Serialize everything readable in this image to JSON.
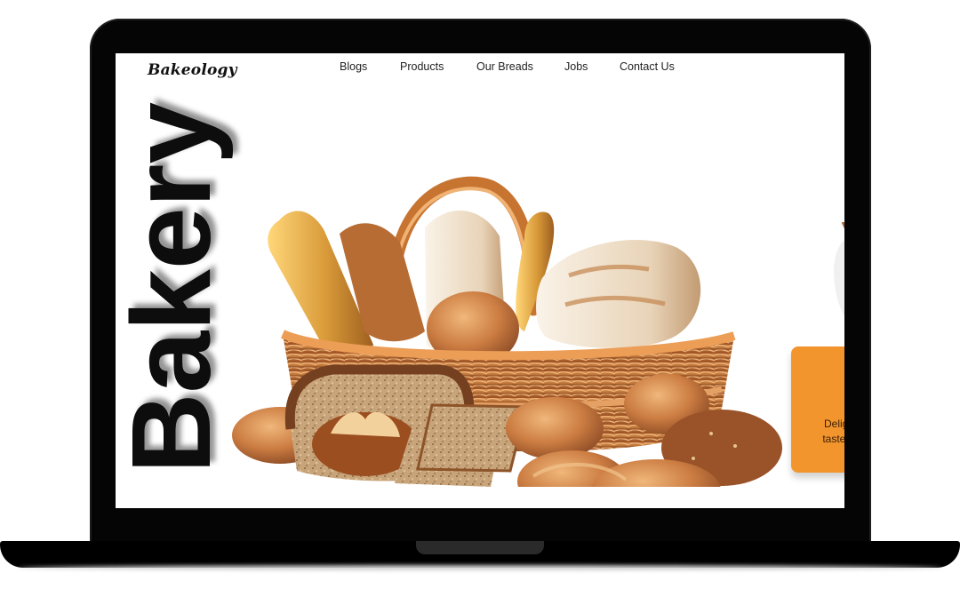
{
  "site": {
    "logo": "Bakeology"
  },
  "nav": {
    "items": [
      "Blogs",
      "Products",
      "Our Breads",
      "Jobs",
      "Contact Us"
    ]
  },
  "hero": {
    "title": "Bakery"
  },
  "side_panel": {
    "line1": "Deligh",
    "line2": "taste & "
  },
  "colors": {
    "accent": "#f3952d",
    "text": "#111111",
    "frame": "#050505"
  }
}
